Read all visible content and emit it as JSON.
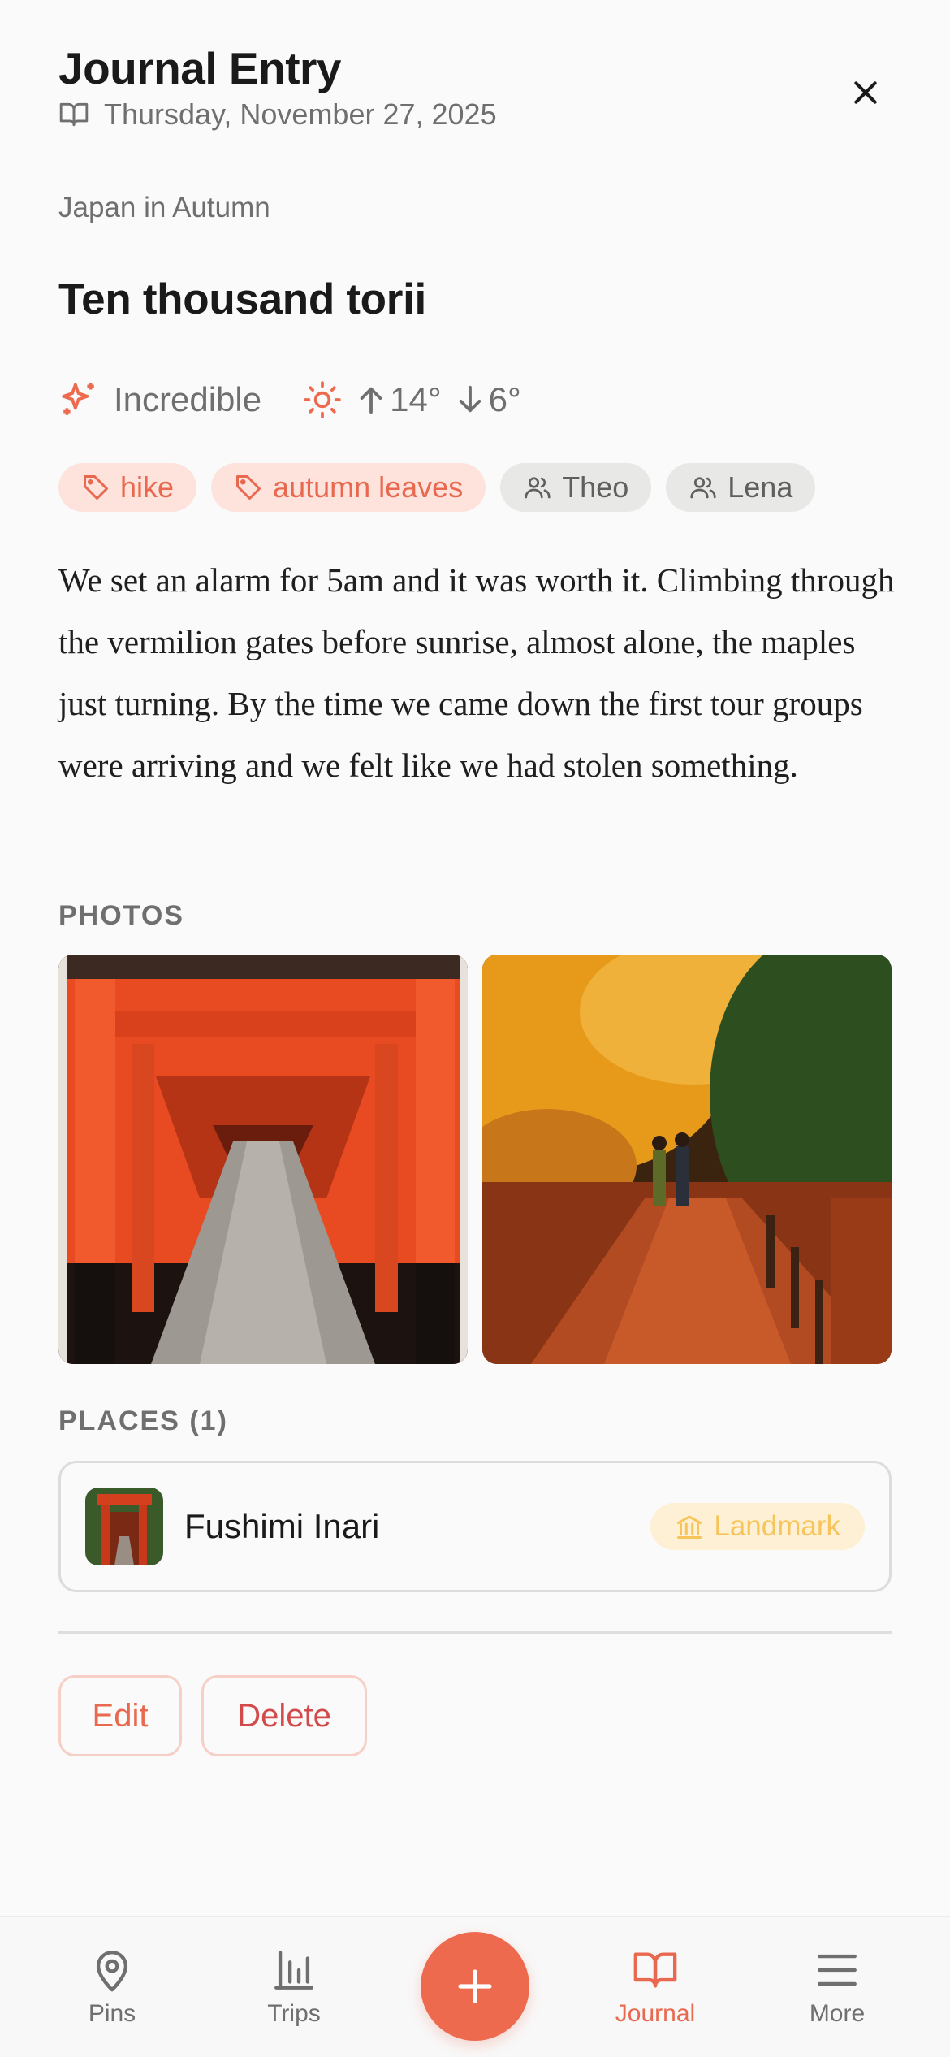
{
  "header": {
    "title": "Journal Entry",
    "date": "Thursday, November 27, 2025"
  },
  "entry": {
    "trip": "Japan in Autumn",
    "title": "Ten thousand torii",
    "mood": "Incredible",
    "temp_high": "14°",
    "temp_low": "6°",
    "tags": [
      {
        "label": "hike",
        "kind": "topic"
      },
      {
        "label": "autumn leaves",
        "kind": "topic"
      },
      {
        "label": "Theo",
        "kind": "person"
      },
      {
        "label": "Lena",
        "kind": "person"
      }
    ],
    "body": "We set an alarm for 5am and it was worth it. Climbing through the vermilion gates before sunrise, almost alone, the maples just turning. By the time we came down the first tour groups were arriving and we felt like we had stolen something."
  },
  "photos_label": "PHOTOS",
  "places_label": "PLACES (1)",
  "places": [
    {
      "name": "Fushimi Inari",
      "category": "Landmark"
    }
  ],
  "actions": {
    "edit": "Edit",
    "delete": "Delete"
  },
  "tabbar": {
    "items": [
      {
        "label": "Pins",
        "icon": "map-pin-icon"
      },
      {
        "label": "Trips",
        "icon": "bar-chart-icon"
      },
      {
        "label": "Journal",
        "icon": "book-open-icon",
        "active": true
      },
      {
        "label": "More",
        "icon": "menu-icon"
      }
    ],
    "fab_icon": "plus-icon"
  },
  "colors": {
    "accent": "#ee6a4e",
    "tag_topic_bg": "#fde3dc",
    "tag_person_bg": "#e8e8e6",
    "badge_bg": "#fdf0d4",
    "badge_text": "#f7c45a",
    "delete": "#d24a4a"
  }
}
